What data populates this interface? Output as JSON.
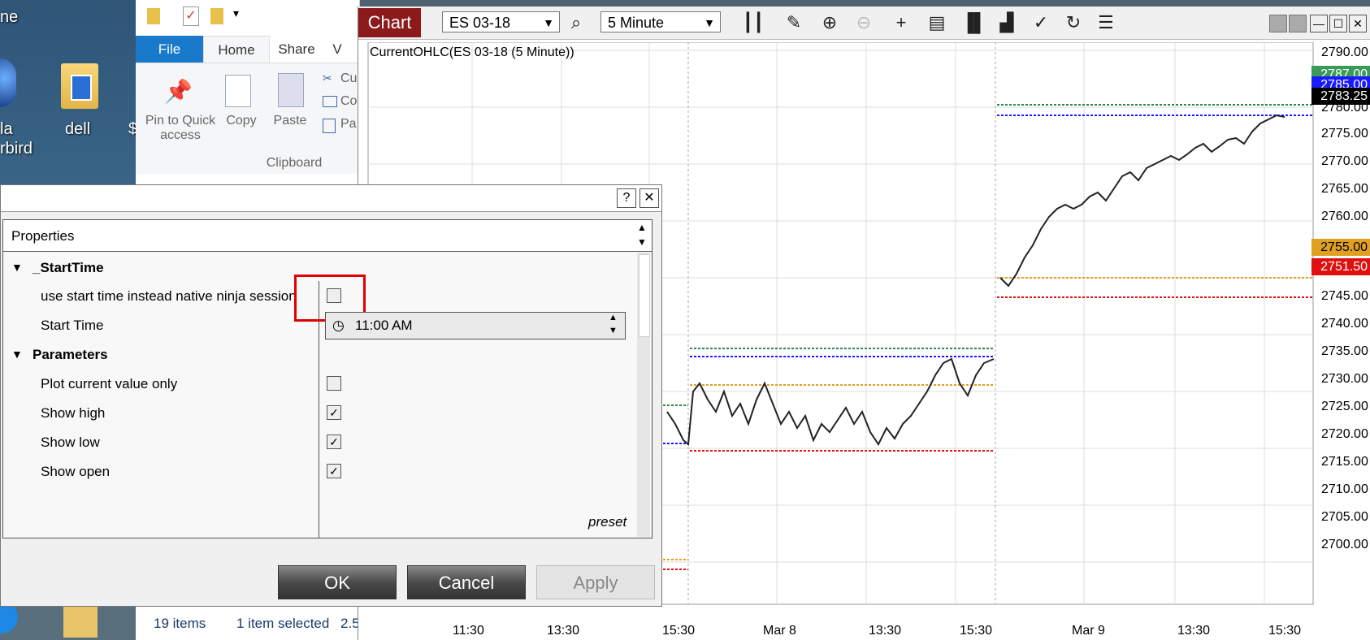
{
  "desktop": {
    "icons": [
      {
        "label": "dell"
      }
    ],
    "partial_labels": [
      "la",
      "rbird",
      "ne",
      "$"
    ]
  },
  "explorer": {
    "tabs": [
      "File",
      "Home",
      "Share",
      "V"
    ],
    "clipboard": {
      "group_label": "Clipboard",
      "pin_label": "Pin to Quick access",
      "copy_label": "Copy",
      "paste_label": "Paste",
      "cut_label": "Cu",
      "copypath_label": "Co",
      "pasteshortcut_label": "Pa"
    },
    "status": {
      "items": "19 items",
      "selected": "1 item selected",
      "size": "2.5"
    }
  },
  "chart": {
    "tab_label": "Chart",
    "instrument": "ES 03-18",
    "interval": "5 Minute",
    "indicator_label": "CurrentOHLC(ES 03-18 (5 Minute))",
    "price_badges": [
      {
        "value": "2787.00",
        "color": "#3a9a5a"
      },
      {
        "value": "2785.00",
        "color": "#1a1aff"
      },
      {
        "value": "2783.25",
        "color": "#000000"
      },
      {
        "value": "2755.00",
        "color": "#e0a020"
      },
      {
        "value": "2751.50",
        "color": "#e01010"
      }
    ],
    "y_ticks": [
      "2790.00",
      "2780.00",
      "2775.00",
      "2770.00",
      "2765.00",
      "2760.00",
      "2745.00",
      "2740.00",
      "2735.00",
      "2730.00",
      "2725.00",
      "2720.00",
      "2715.00",
      "2710.00",
      "2705.00",
      "2700.00"
    ],
    "x_ticks": [
      "11:30",
      "13:30",
      "15:30",
      "Mar 8",
      "13:30",
      "15:30",
      "Mar 9",
      "13:30",
      "15:30"
    ]
  },
  "dialog": {
    "section_header": "Properties",
    "groups": [
      {
        "name": "_StartTime",
        "rows": [
          {
            "label": "use start time instead native ninja session",
            "type": "checkbox",
            "checked": false
          },
          {
            "label": "Start Time",
            "type": "time",
            "value": "11:00 AM"
          }
        ]
      },
      {
        "name": "Parameters",
        "rows": [
          {
            "label": "Plot current value only",
            "type": "checkbox",
            "checked": false
          },
          {
            "label": "Show high",
            "type": "checkbox",
            "checked": true
          },
          {
            "label": "Show low",
            "type": "checkbox",
            "checked": true
          },
          {
            "label": "Show open",
            "type": "checkbox",
            "checked": true
          }
        ]
      }
    ],
    "preset_label": "preset",
    "ok_label": "OK",
    "cancel_label": "Cancel",
    "apply_label": "Apply",
    "help_label": "?",
    "close_label": "✕"
  }
}
